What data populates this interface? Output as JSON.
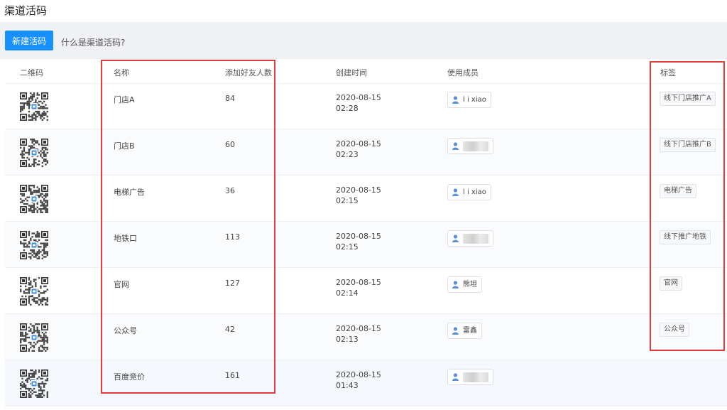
{
  "page": {
    "title": "渠道活码"
  },
  "toolbar": {
    "new_button": "新建活码",
    "help_link": "什么是渠道活码?"
  },
  "table": {
    "columns": {
      "qrcode": "二维码",
      "name": "名称",
      "friends": "添加好友人数",
      "created": "创建时间",
      "members": "使用成员",
      "tags": "标签"
    },
    "rows": [
      {
        "name": "门店A",
        "friends": "84",
        "date": "2020-08-15",
        "time": "02:28",
        "member": "l i xiao",
        "member_blurred": false,
        "tag": "线下门店推广A"
      },
      {
        "name": "门店B",
        "friends": "60",
        "date": "2020-08-15",
        "time": "02:23",
        "member": "",
        "member_blurred": true,
        "tag": "线下门店推广B"
      },
      {
        "name": "电梯广告",
        "friends": "36",
        "date": "2020-08-15",
        "time": "02:15",
        "member": "l i xiao",
        "member_blurred": false,
        "tag": "电梯广告"
      },
      {
        "name": "地铁口",
        "friends": "113",
        "date": "2020-08-15",
        "time": "02:15",
        "member": "",
        "member_blurred": true,
        "tag": "线下推广地铁"
      },
      {
        "name": "官网",
        "friends": "127",
        "date": "2020-08-15",
        "time": "02:14",
        "member": "熊坦",
        "member_blurred": false,
        "tag": "官网"
      },
      {
        "name": "公众号",
        "friends": "42",
        "date": "2020-08-15",
        "time": "02:13",
        "member": "雷鑫",
        "member_blurred": false,
        "tag": "公众号"
      },
      {
        "name": "百度竞价",
        "friends": "161",
        "date": "2020-08-15",
        "time": "01:43",
        "member": "",
        "member_blurred": true,
        "tag": ""
      }
    ]
  },
  "colors": {
    "primary": "#1890ff",
    "highlight": "#e23b3b",
    "toolbar_bg": "#eff1f4"
  },
  "icons": {
    "member": "user-icon",
    "qr": "qr-code-icon"
  }
}
